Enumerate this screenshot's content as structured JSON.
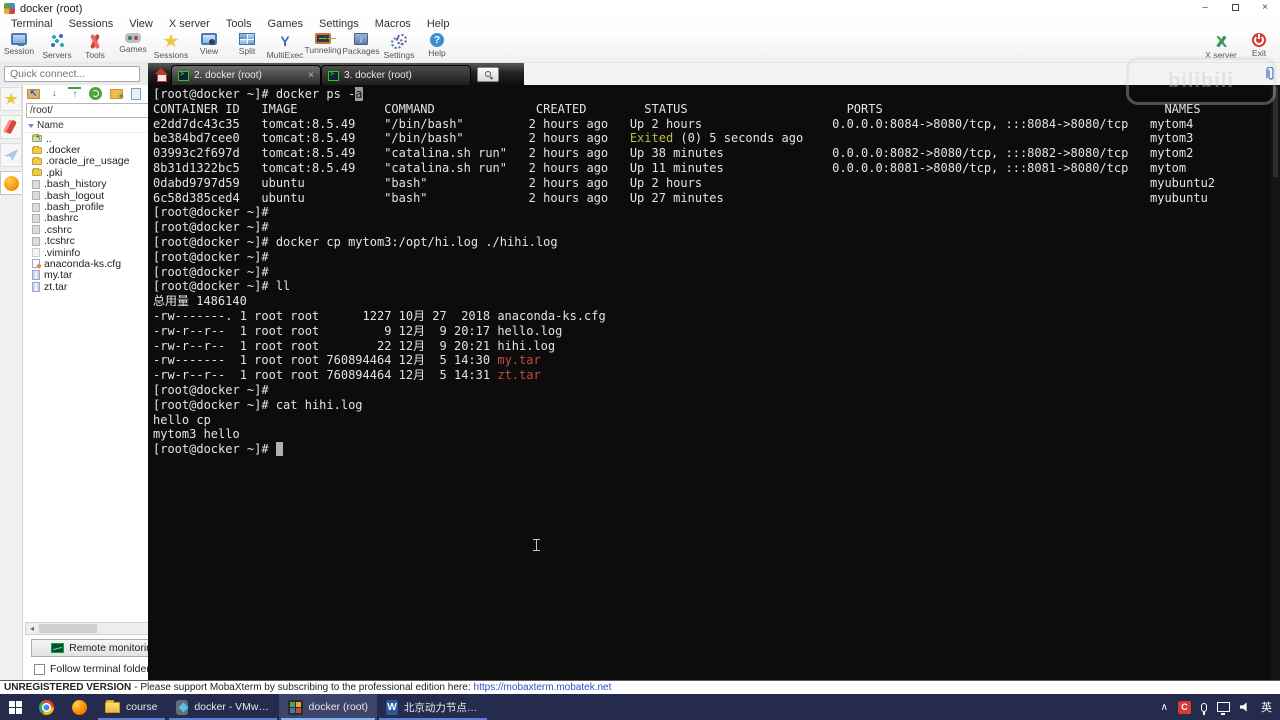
{
  "colors": {
    "terminal_bg": "#0c0c0c",
    "terminal_fg": "#e4e4e4",
    "exited_yellow": "#b9bb41",
    "archive_red": "#c04b45",
    "link_blue": "#2b50c8",
    "taskbar_bg": "#242b4d",
    "taskbar_accent": "#86b2f0"
  },
  "window": {
    "title": "docker (root)",
    "controls": [
      {
        "name": "minimize",
        "glyph": "–"
      },
      {
        "name": "restore",
        "glyph": ""
      },
      {
        "name": "close",
        "glyph": "×"
      }
    ]
  },
  "menu": {
    "items": [
      "Terminal",
      "Sessions",
      "View",
      "X server",
      "Tools",
      "Games",
      "Settings",
      "Macros",
      "Help"
    ]
  },
  "toolbar": {
    "items": [
      {
        "label": "Session",
        "icon": "session"
      },
      {
        "label": "Servers",
        "icon": "servers"
      },
      {
        "label": "Tools",
        "icon": "tools"
      },
      {
        "label": "Games",
        "icon": "games"
      },
      {
        "label": "Sessions",
        "icon": "sessions-star"
      },
      {
        "label": "View",
        "icon": "view"
      },
      {
        "label": "Split",
        "icon": "split"
      },
      {
        "label": "MultiExec",
        "icon": "multiexec"
      },
      {
        "label": "Tunneling",
        "icon": "tunneling"
      },
      {
        "label": "Packages",
        "icon": "packages"
      },
      {
        "label": "Settings",
        "icon": "settings"
      },
      {
        "label": "Help",
        "icon": "help"
      }
    ],
    "right_items": [
      {
        "label": "X server",
        "icon": "xserver"
      },
      {
        "label": "Exit",
        "icon": "exit"
      }
    ]
  },
  "watermark": "bilibili",
  "session_bar": {
    "quick_connect_placeholder": "Quick connect...",
    "tabs": [
      {
        "label": "2. docker (root)",
        "active": true,
        "closable": true,
        "close_glyph": "×"
      },
      {
        "label": "3. docker (root)",
        "active": false,
        "closable": false
      }
    ]
  },
  "sidebar": {
    "strip": [
      {
        "name": "sessions",
        "icon": "star"
      },
      {
        "name": "tools",
        "icon": "knife"
      },
      {
        "name": "macros",
        "icon": "plane"
      },
      {
        "name": "sftp",
        "icon": "sphere",
        "active": true
      }
    ],
    "file_toolbar": [
      {
        "name": "go-up-folder",
        "cls": "fp-goup",
        "glyph": "↖"
      },
      {
        "name": "download",
        "cls": "fp-down",
        "glyph": "↓"
      },
      {
        "name": "upload",
        "cls": "fp-up",
        "glyph": "↑"
      },
      {
        "name": "refresh",
        "cls": "fp-refresh",
        "glyph": ""
      },
      {
        "name": "new-folder",
        "cls": "fp-newfolder",
        "glyph": ""
      },
      {
        "name": "new-file",
        "cls": "fp-newfile",
        "glyph": ""
      },
      {
        "name": "delete",
        "cls": "fp-del",
        "glyph": ""
      },
      {
        "name": "rename",
        "cls": "fp-rename",
        "glyph": "A"
      }
    ],
    "path": "/root/",
    "path_ok_glyph": "✓",
    "tree_header": "Name",
    "tree": [
      {
        "label": "..",
        "icon": "folder-up"
      },
      {
        "label": ".docker",
        "icon": "folder"
      },
      {
        "label": ".oracle_jre_usage",
        "icon": "folder"
      },
      {
        "label": ".pki",
        "icon": "folder"
      },
      {
        "label": ".bash_history",
        "icon": "file"
      },
      {
        "label": ".bash_logout",
        "icon": "file"
      },
      {
        "label": ".bash_profile",
        "icon": "file"
      },
      {
        "label": ".bashrc",
        "icon": "file"
      },
      {
        "label": ".cshrc",
        "icon": "file"
      },
      {
        "label": ".tcshrc",
        "icon": "file"
      },
      {
        "label": ".viminfo",
        "icon": "file-light"
      },
      {
        "label": "anaconda-ks.cfg",
        "icon": "file-cfg"
      },
      {
        "label": "my.tar",
        "icon": "file-tar"
      },
      {
        "label": "zt.tar",
        "icon": "file-tar"
      }
    ],
    "remote_monitoring": "Remote monitoring",
    "follow_terminal_folder": "Follow terminal folder"
  },
  "terminal": {
    "lines": [
      {
        "segs": [
          {
            "t": "[root@docker ~]# docker ps -"
          },
          {
            "t": "a",
            "c": "s"
          }
        ]
      },
      {
        "segs": [
          {
            "t": "CONTAINER ID   IMAGE            COMMAND              CREATED        STATUS                      PORTS                                       NAMES"
          }
        ]
      },
      {
        "segs": [
          {
            "t": "e2dd7dc43c35   tomcat:8.5.49    \"/bin/bash\"         2 hours ago   Up 2 hours                  0.0.0.0:8084->8080/tcp, :::8084->8080/tcp   mytom4"
          }
        ]
      },
      {
        "segs": [
          {
            "t": "be384bd7cee0   tomcat:8.5.49    \"/bin/bash\"         2 hours ago   "
          },
          {
            "t": "Exited",
            "c": "y"
          },
          {
            "t": " (0) 5 seconds ago                                                mytom3"
          }
        ]
      },
      {
        "segs": [
          {
            "t": "03993c2f697d   tomcat:8.5.49    \"catalina.sh run\"   2 hours ago   Up 38 minutes               0.0.0.0:8082->8080/tcp, :::8082->8080/tcp   mytom2"
          }
        ]
      },
      {
        "segs": [
          {
            "t": "8b31d1322bc5   tomcat:8.5.49    \"catalina.sh run\"   2 hours ago   Up 11 minutes               0.0.0.0:8081->8080/tcp, :::8081->8080/tcp   mytom"
          }
        ]
      },
      {
        "segs": [
          {
            "t": "0dabd9797d59   ubuntu           \"bash\"              2 hours ago   Up 2 hours                                                              myubuntu2"
          }
        ]
      },
      {
        "segs": [
          {
            "t": "6c58d385ced4   ubuntu           \"bash\"              2 hours ago   Up 27 minutes                                                           myubuntu"
          }
        ]
      },
      {
        "segs": [
          {
            "t": "[root@docker ~]#"
          }
        ]
      },
      {
        "segs": [
          {
            "t": "[root@docker ~]#"
          }
        ]
      },
      {
        "segs": [
          {
            "t": "[root@docker ~]# docker cp mytom3:/opt/hi.log ./hihi.log"
          }
        ]
      },
      {
        "segs": [
          {
            "t": "[root@docker ~]#"
          }
        ]
      },
      {
        "segs": [
          {
            "t": "[root@docker ~]#"
          }
        ]
      },
      {
        "segs": [
          {
            "t": "[root@docker ~]# ll"
          }
        ]
      },
      {
        "segs": [
          {
            "t": "总用量 1486140"
          }
        ]
      },
      {
        "segs": [
          {
            "t": "-rw-------. 1 root root      1227 10月 27  2018 anaconda-ks.cfg"
          }
        ]
      },
      {
        "segs": [
          {
            "t": "-rw-r--r--  1 root root         9 12月  9 20:17 hello.log"
          }
        ]
      },
      {
        "segs": [
          {
            "t": "-rw-r--r--  1 root root        22 12月  9 20:21 hihi.log"
          }
        ]
      },
      {
        "segs": [
          {
            "t": "-rw-------  1 root root 760894464 12月  5 14:30 "
          },
          {
            "t": "my.tar",
            "c": "r"
          }
        ]
      },
      {
        "segs": [
          {
            "t": "-rw-r--r--  1 root root 760894464 12月  5 14:31 "
          },
          {
            "t": "zt.tar",
            "c": "r"
          }
        ]
      },
      {
        "segs": [
          {
            "t": "[root@docker ~]#"
          }
        ]
      },
      {
        "segs": [
          {
            "t": "[root@docker ~]# cat hihi.log"
          }
        ]
      },
      {
        "segs": [
          {
            "t": "hello cp"
          }
        ]
      },
      {
        "segs": [
          {
            "t": "mytom3 hello"
          }
        ]
      },
      {
        "segs": [
          {
            "t": "[root@docker ~]# "
          },
          {
            "t": " ",
            "c": "cur"
          }
        ]
      }
    ]
  },
  "statusbar": {
    "bold": "UNREGISTERED VERSION",
    "text": "-  Please support MobaXterm by subscribing to the professional edition here:",
    "link": "https://mobaxterm.mobatek.net"
  },
  "taskbar": {
    "items": [
      {
        "name": "chrome",
        "icon": "chrome",
        "label": "",
        "running": false
      },
      {
        "name": "firefox",
        "icon": "firefox",
        "label": "",
        "running": false
      },
      {
        "name": "explorer-course",
        "icon": "folder",
        "label": "course",
        "running": true
      },
      {
        "name": "vmware",
        "icon": "vmware",
        "label": "docker - VMware...",
        "running": true
      },
      {
        "name": "mobaxterm",
        "icon": "moba",
        "label": "docker (root)",
        "running": true,
        "active": true
      },
      {
        "name": "word",
        "icon": "word",
        "label": "北京动力节点课程-...",
        "running": true
      }
    ],
    "word_icon_glyph": "W",
    "tray": [
      {
        "name": "chevron-up",
        "cls": "tr-chev",
        "glyph": "∧"
      },
      {
        "name": "c-app",
        "cls": "tr-c",
        "glyph": "C"
      },
      {
        "name": "microphone",
        "cls": "tr-mic",
        "glyph": ""
      },
      {
        "name": "display",
        "cls": "tr-disp",
        "glyph": ""
      },
      {
        "name": "volume",
        "cls": "tr-vol",
        "glyph": ""
      }
    ],
    "ime": "英"
  }
}
